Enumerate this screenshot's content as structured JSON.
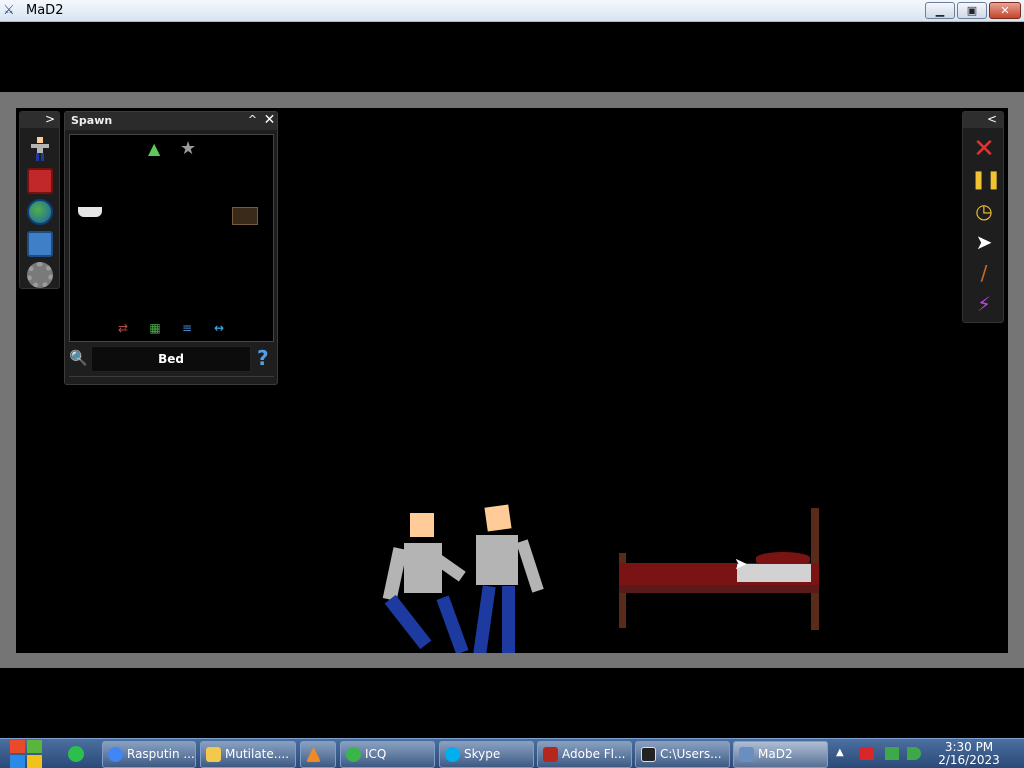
{
  "window": {
    "title": "MaD2",
    "minimize": "▁",
    "maximize": "▣",
    "close": "✕"
  },
  "left_toolbar": {
    "expand": ">"
  },
  "spawn": {
    "title": "Spawn",
    "collapse": "^",
    "close": "✕",
    "items": [
      {
        "icon": "flask-icon",
        "glyph": "▲"
      },
      {
        "icon": "star-icon",
        "glyph": "★"
      },
      {
        "icon": "bathtub-icon",
        "glyph": ""
      },
      {
        "icon": "shelf-icon",
        "glyph": ""
      }
    ],
    "filters": [
      "⇄",
      "▦",
      "≡",
      "↔"
    ],
    "search_value": "Bed",
    "search_glyph": "🔍",
    "help_glyph": "?"
  },
  "right_toolbar": {
    "collapse": "<",
    "tools": [
      {
        "name": "stop",
        "glyph": "✕"
      },
      {
        "name": "pause",
        "glyph": "❚❚"
      },
      {
        "name": "timer",
        "glyph": "◷"
      },
      {
        "name": "pointer",
        "glyph": "➤"
      },
      {
        "name": "knife",
        "glyph": "/"
      },
      {
        "name": "lightning",
        "glyph": "⚡"
      }
    ]
  },
  "taskbar": {
    "tasks": [
      {
        "label": "Rasputin ...",
        "icon_color": "#4285f4"
      },
      {
        "label": "Mutilate....",
        "icon_color": "#f2c94c"
      },
      {
        "label": "",
        "icon_color": "#f08a24"
      },
      {
        "label": "ICQ",
        "icon_color": "#3ab54a"
      },
      {
        "label": "Skype",
        "icon_color": "#00aff0"
      },
      {
        "label": "Adobe Fl...",
        "icon_color": "#b3271e"
      },
      {
        "label": "C:\\Users...",
        "icon_color": "#222222"
      },
      {
        "label": "MaD2",
        "icon_color": "#6a8ec0"
      }
    ],
    "clock_time": "3:30 PM",
    "clock_date": "2/16/2023"
  },
  "colors": {
    "skin": "#ffcc99",
    "shirt": "#b4b4b4",
    "pants": "#1c3aa0",
    "bed_frame": "#7a1414",
    "sheet": "#d2d2d2"
  }
}
